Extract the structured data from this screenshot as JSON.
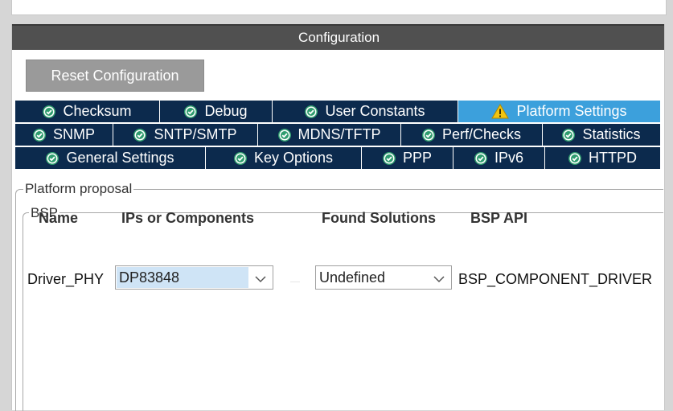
{
  "panel": {
    "title": "Configuration"
  },
  "toolbar": {
    "reset_label": "Reset Configuration"
  },
  "tabs": {
    "row1": [
      {
        "label": "Checksum",
        "icon": "check-circle-icon"
      },
      {
        "label": "Debug",
        "icon": "check-circle-icon"
      },
      {
        "label": "User Constants",
        "icon": "check-circle-icon"
      },
      {
        "label": "Platform Settings",
        "icon": "warning-icon",
        "active": true
      }
    ],
    "row2": [
      {
        "label": "SNMP",
        "icon": "check-circle-icon"
      },
      {
        "label": "SNTP/SMTP",
        "icon": "check-circle-icon"
      },
      {
        "label": "MDNS/TFTP",
        "icon": "check-circle-icon"
      },
      {
        "label": "Perf/Checks",
        "icon": "check-circle-icon"
      },
      {
        "label": "Statistics",
        "icon": "check-circle-icon"
      }
    ],
    "row3": [
      {
        "label": "General Settings",
        "icon": "check-circle-icon"
      },
      {
        "label": "Key Options",
        "icon": "check-circle-icon"
      },
      {
        "label": "PPP",
        "icon": "check-circle-icon"
      },
      {
        "label": "IPv6",
        "icon": "check-circle-icon"
      },
      {
        "label": "HTTPD",
        "icon": "check-circle-icon"
      }
    ]
  },
  "platform": {
    "legend": "Platform proposal",
    "bsp_legend": "BSP",
    "columns": {
      "name": "Name",
      "ips": "IPs or Components",
      "found": "Found Solutions",
      "api": "BSP API"
    },
    "row": {
      "name": "Driver_PHY",
      "ip_value": "DP83848",
      "found_value": "Undefined",
      "api_value": "BSP_COMPONENT_DRIVER"
    }
  },
  "colors": {
    "tab_bg": "#0c2a4d",
    "tab_active_bg": "#3ca0dc",
    "header_bg": "#505050",
    "check_icon": "#2e9c6e",
    "warning_icon": "#f2c40f"
  }
}
